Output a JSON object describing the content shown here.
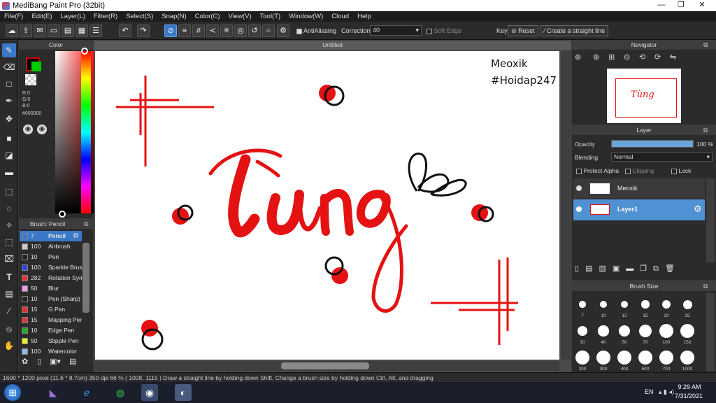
{
  "window": {
    "title": "MediBang Paint Pro (32bit)",
    "min": "—",
    "max": "❐",
    "close": "✕"
  },
  "menu": [
    "File(F)",
    "Edit(E)",
    "Layer(L)",
    "Filter(R)",
    "Select(S)",
    "Snap(N)",
    "Color(C)",
    "View(V)",
    "Tool(T)",
    "Window(W)",
    "Cloud",
    "Help"
  ],
  "toolbar": {
    "antialiasing_label": "AntiAliasing",
    "correction_label": "Correction",
    "correction_value": "40",
    "soft_edge_label": "Soft Edge",
    "key_label": "Key",
    "reset_label": "Reset",
    "straight_line_label": "Create a straight line"
  },
  "color_panel": {
    "title": "Color",
    "r": "R:0",
    "g": "G:0",
    "b": "B:0",
    "hex": "#000000",
    "fg_color": "#000000",
    "bg_color": "#00cc00"
  },
  "brush_panel": {
    "title": "Brush: Pencil",
    "items": [
      {
        "size": "7",
        "name": "Pencil",
        "color": "#3a78c8"
      },
      {
        "size": "100",
        "name": "Airbrush",
        "color": "#c8c8c8"
      },
      {
        "size": "10",
        "name": "Pen",
        "color": "#222222"
      },
      {
        "size": "100",
        "name": "Sparkle Brush",
        "color": "#3344dd"
      },
      {
        "size": "282",
        "name": "Rotation Sym",
        "color": "#dd3333"
      },
      {
        "size": "50",
        "name": "Blur",
        "color": "#ee99ee"
      },
      {
        "size": "10",
        "name": "Pen (Sharp)",
        "color": "#222222"
      },
      {
        "size": "15",
        "name": "G Pen",
        "color": "#dd3333"
      },
      {
        "size": "15",
        "name": "Mapping Pen",
        "color": "#dd3333"
      },
      {
        "size": "10",
        "name": "Edge Pen",
        "color": "#22aa22"
      },
      {
        "size": "50",
        "name": "Stipple Pen",
        "color": "#eeee22"
      },
      {
        "size": "100",
        "name": "Watercolor",
        "color": "#88bbee"
      }
    ]
  },
  "canvas": {
    "tab_title": "Untitled",
    "caption_line1": "Meoxik",
    "caption_line2": "#Hoidap247",
    "word": "Tùng"
  },
  "navigator": {
    "title": "Navigator"
  },
  "layer_panel": {
    "title": "Layer",
    "opacity_label": "Opacity",
    "opacity_value": "100 %",
    "opacity_fraction": 1.0,
    "blending_label": "Blending",
    "blending_value": "Normal",
    "protect_alpha": "Protect Alpha",
    "clipping": "Clipping",
    "lock": "Lock",
    "layers": [
      {
        "name": "Meoxik",
        "selected": false
      },
      {
        "name": "Layer1",
        "selected": true
      }
    ]
  },
  "brush_size": {
    "title": "Brush Size",
    "sizes": [
      "7",
      "10",
      "12",
      "15",
      "20",
      "25",
      "30",
      "40",
      "50",
      "70",
      "100",
      "150",
      "200",
      "300",
      "400",
      "500",
      "700",
      "1000"
    ]
  },
  "status": {
    "text": "1600 * 1200 pixel  (11.6 * 8.7cm)  350 dpi  66 %  ( 1008, 1115 )  Draw a straight line by holding down Shift, Change a brush size by holding down Ctrl, Alt, and dragging"
  },
  "taskbar": {
    "lang": "EN",
    "time": "9:29 AM",
    "date": "7/31/2021"
  }
}
